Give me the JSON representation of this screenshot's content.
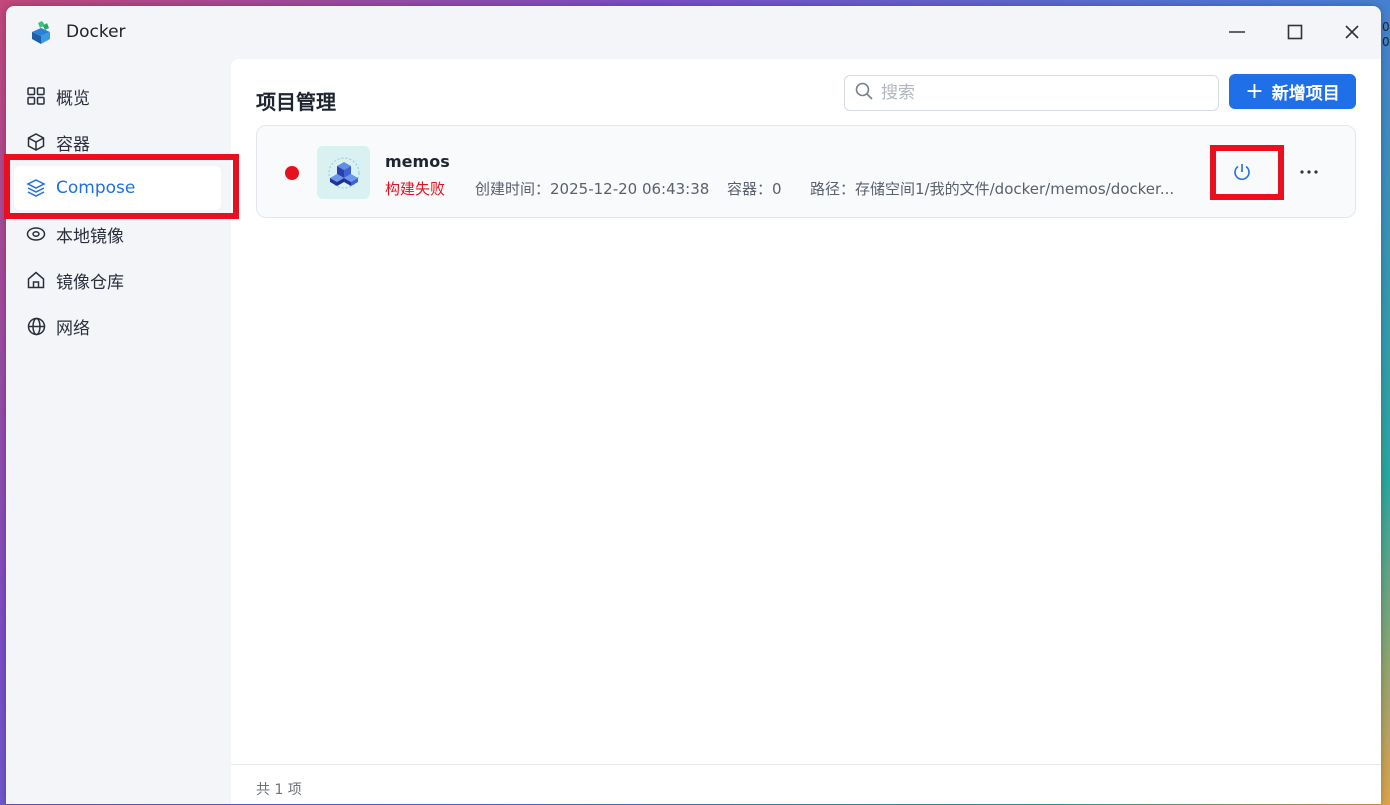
{
  "window": {
    "title": "Docker",
    "controls": [
      "minimize",
      "maximize",
      "close"
    ]
  },
  "sidebar": {
    "items": [
      {
        "label": "概览",
        "icon": "grid-icon"
      },
      {
        "label": "容器",
        "icon": "cube-icon"
      },
      {
        "label": "Compose",
        "icon": "layers-icon",
        "active": true
      },
      {
        "label": "本地镜像",
        "icon": "disc-icon"
      },
      {
        "label": "镜像仓库",
        "icon": "home-icon"
      },
      {
        "label": "网络",
        "icon": "globe-icon"
      }
    ]
  },
  "main": {
    "title": "项目管理",
    "search": {
      "placeholder": "搜索",
      "value": ""
    },
    "add_button": {
      "label": "新增项目"
    },
    "projects": [
      {
        "name": "memos",
        "status": "构建失败",
        "status_color": "#e8101f",
        "created_label": "创建时间：",
        "created_value": "2025-12-20 06:43:38",
        "containers_label": "容器：",
        "containers_value": "0",
        "path_label": "路径：",
        "path_value": "存储空间1/我的文件/docker/memos/docker..."
      }
    ],
    "footer": "共 1 项"
  },
  "edge_text": [
    "0",
    "0"
  ],
  "colors": {
    "accent": "#1e6fe8",
    "error": "#e8101f",
    "highlight": "#e8101f"
  }
}
